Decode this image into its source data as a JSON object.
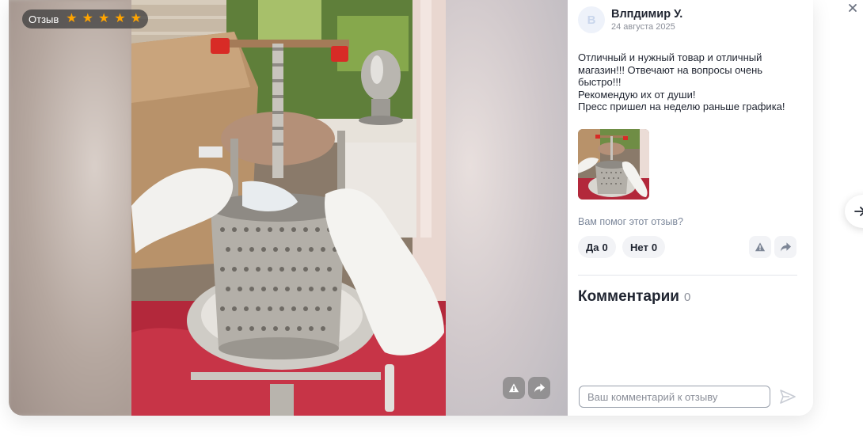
{
  "badge": {
    "label": "Отзыв",
    "rating": 5,
    "star_color": "#ffa400"
  },
  "author": {
    "initial": "В",
    "name": "Влпдимир У.",
    "date": "24 августа 2025"
  },
  "review": {
    "text": "Отличный и нужный товар и отличный магазин!!! Отвечают на вопросы очень быстро!!!\nРекомендую их от души!\nПресс пришел на неделю раньше графика!"
  },
  "helpful": {
    "question": "Вам помог этот отзыв?",
    "yes_label": "Да",
    "yes_count": "0",
    "no_label": "Нет",
    "no_count": "0"
  },
  "comments": {
    "title": "Комментарии",
    "count": "0",
    "input_placeholder": "Ваш комментарий к отзыву"
  },
  "icons": {
    "complaint": "warning-icon",
    "share": "share-icon",
    "send": "send-icon",
    "close": "close-icon",
    "next": "arrow-right-icon",
    "star": "star-icon"
  },
  "colors": {
    "accent_star": "#ffa400",
    "text_primary": "#1f2430",
    "text_secondary": "#8b8f99",
    "muted_button": "#f2f3f6"
  }
}
